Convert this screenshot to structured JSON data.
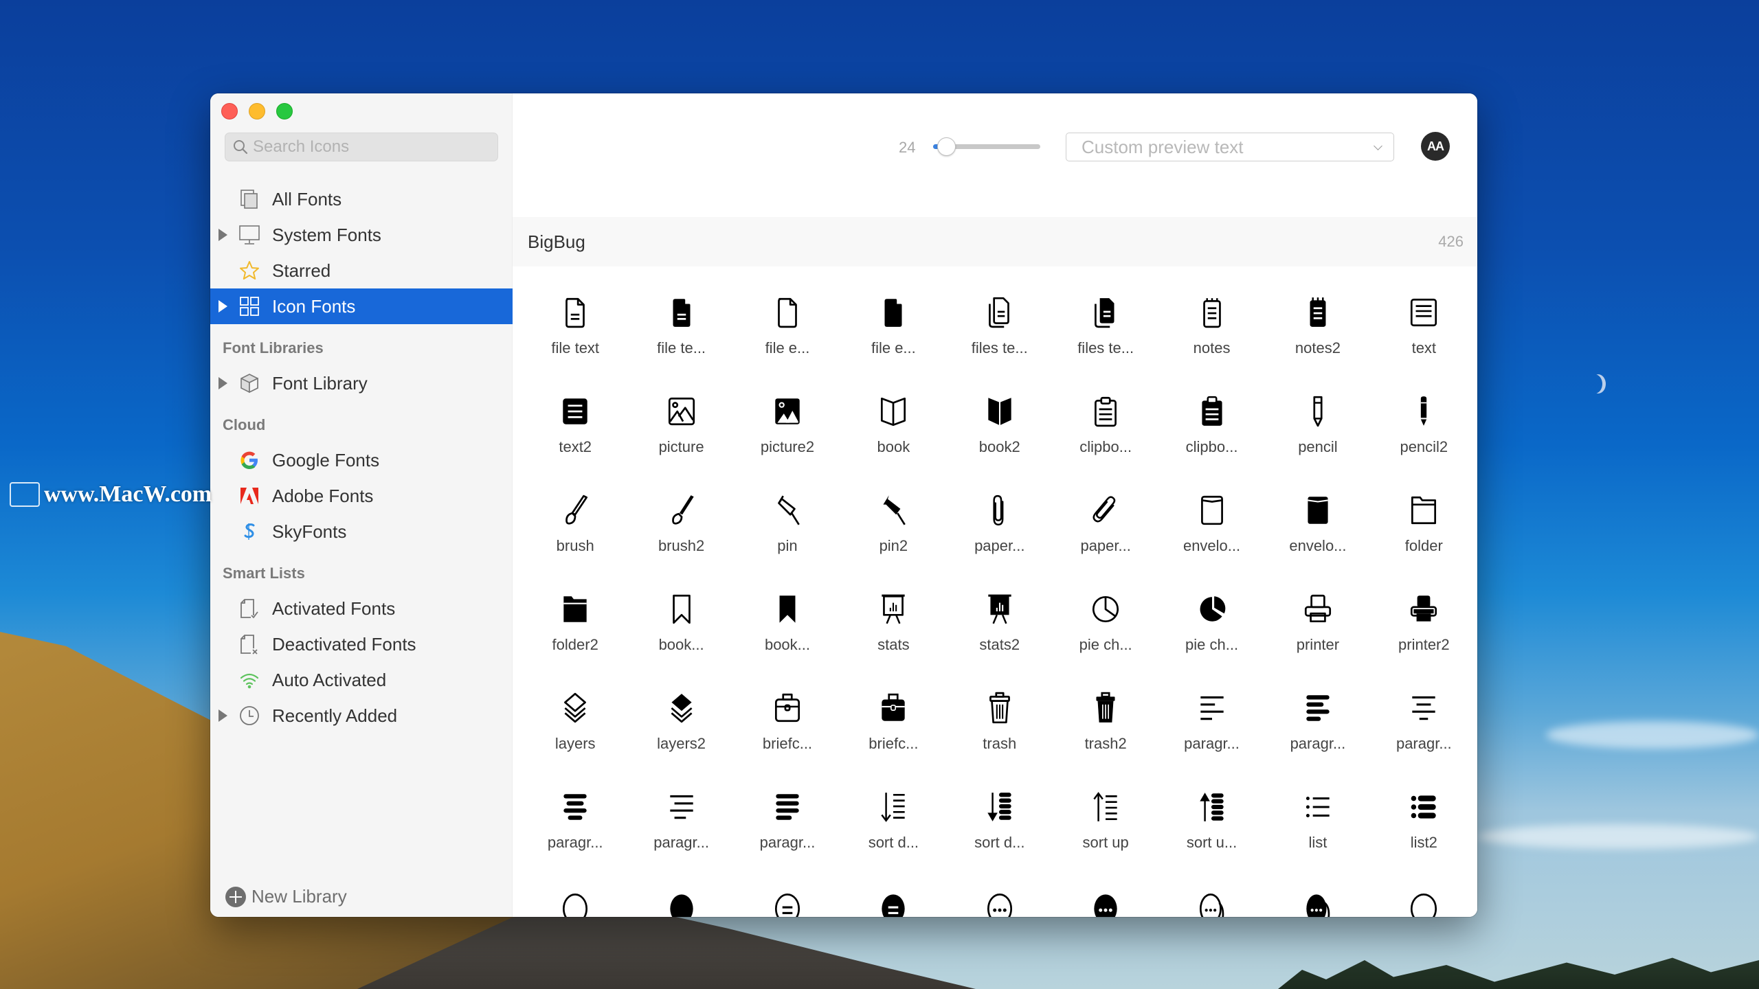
{
  "desktop": {
    "watermark": "www.MacW.com"
  },
  "window": {
    "controls": [
      "close",
      "minimize",
      "zoom"
    ]
  },
  "sidebar": {
    "search_placeholder": "Search Icons",
    "search_value": "",
    "top_items": [
      {
        "label": "All Fonts",
        "icon": "all-fonts-icon",
        "disclosure": false,
        "selected": false
      },
      {
        "label": "System Fonts",
        "icon": "monitor-icon",
        "disclosure": true,
        "selected": false
      },
      {
        "label": "Starred",
        "icon": "star-icon",
        "disclosure": false,
        "selected": false
      },
      {
        "label": "Icon Fonts",
        "icon": "grid-icon",
        "disclosure": true,
        "selected": true
      }
    ],
    "sections": [
      {
        "heading": "Font Libraries",
        "items": [
          {
            "label": "Font Library",
            "icon": "cube-icon",
            "disclosure": true
          }
        ]
      },
      {
        "heading": "Cloud",
        "items": [
          {
            "label": "Google Fonts",
            "icon": "google-icon",
            "disclosure": false
          },
          {
            "label": "Adobe Fonts",
            "icon": "adobe-icon",
            "disclosure": false
          },
          {
            "label": "SkyFonts",
            "icon": "skyfonts-icon",
            "disclosure": false
          }
        ]
      },
      {
        "heading": "Smart Lists",
        "items": [
          {
            "label": "Activated Fonts",
            "icon": "doc-check-icon",
            "disclosure": false
          },
          {
            "label": "Deactivated Fonts",
            "icon": "doc-x-icon",
            "disclosure": false
          },
          {
            "label": "Auto Activated",
            "icon": "wifi-icon",
            "disclosure": false
          },
          {
            "label": "Recently Added",
            "icon": "clock-icon",
            "disclosure": true
          }
        ]
      }
    ],
    "new_library_label": "New Library"
  },
  "toolbar": {
    "size_value": "24",
    "size_slider_fraction": 0.12,
    "preview_placeholder": "Custom preview text",
    "aa_label": "AA"
  },
  "font": {
    "name": "BigBug",
    "count": "426"
  },
  "colors": {
    "selection": "#1868d9",
    "slider_fill": "#3b82e0",
    "google_blue": "#4285f4",
    "adobe_red": "#e8291c",
    "skyfonts_blue": "#2f8fe6",
    "auto_green": "#5dc35d",
    "star_yellow": "#f1b92c"
  },
  "icons": [
    {
      "label": "file text",
      "glyph": "file-text"
    },
    {
      "label": "file te...",
      "glyph": "file-text-solid"
    },
    {
      "label": "file e...",
      "glyph": "file-empty"
    },
    {
      "label": "file e...",
      "glyph": "file-empty-solid"
    },
    {
      "label": "files te...",
      "glyph": "files-text"
    },
    {
      "label": "files te...",
      "glyph": "files-text-solid"
    },
    {
      "label": "notes",
      "glyph": "notes"
    },
    {
      "label": "notes2",
      "glyph": "notes-solid"
    },
    {
      "label": "text",
      "glyph": "text"
    },
    {
      "label": "text2",
      "glyph": "text-solid"
    },
    {
      "label": "picture",
      "glyph": "picture"
    },
    {
      "label": "picture2",
      "glyph": "picture-solid"
    },
    {
      "label": "book",
      "glyph": "book"
    },
    {
      "label": "book2",
      "glyph": "book-solid"
    },
    {
      "label": "clipbo...",
      "glyph": "clipboard"
    },
    {
      "label": "clipbo...",
      "glyph": "clipboard-solid"
    },
    {
      "label": "pencil",
      "glyph": "pencil"
    },
    {
      "label": "pencil2",
      "glyph": "pencil-solid"
    },
    {
      "label": "brush",
      "glyph": "brush"
    },
    {
      "label": "brush2",
      "glyph": "brush-solid"
    },
    {
      "label": "pin",
      "glyph": "pin"
    },
    {
      "label": "pin2",
      "glyph": "pin-solid"
    },
    {
      "label": "paper...",
      "glyph": "paperclip"
    },
    {
      "label": "paper...",
      "glyph": "paperclip-tilted"
    },
    {
      "label": "envelo...",
      "glyph": "envelope"
    },
    {
      "label": "envelo...",
      "glyph": "envelope-solid"
    },
    {
      "label": "folder",
      "glyph": "folder"
    },
    {
      "label": "folder2",
      "glyph": "folder-solid"
    },
    {
      "label": "book...",
      "glyph": "bookmark"
    },
    {
      "label": "book...",
      "glyph": "bookmark-solid"
    },
    {
      "label": "stats",
      "glyph": "stats"
    },
    {
      "label": "stats2",
      "glyph": "stats-solid"
    },
    {
      "label": "pie ch...",
      "glyph": "pie-chart"
    },
    {
      "label": "pie ch...",
      "glyph": "pie-chart-solid"
    },
    {
      "label": "printer",
      "glyph": "printer"
    },
    {
      "label": "printer2",
      "glyph": "printer-solid"
    },
    {
      "label": "layers",
      "glyph": "layers"
    },
    {
      "label": "layers2",
      "glyph": "layers-solid"
    },
    {
      "label": "briefc...",
      "glyph": "briefcase"
    },
    {
      "label": "briefc...",
      "glyph": "briefcase-solid"
    },
    {
      "label": "trash",
      "glyph": "trash"
    },
    {
      "label": "trash2",
      "glyph": "trash-solid"
    },
    {
      "label": "paragr...",
      "glyph": "paragraph-left"
    },
    {
      "label": "paragr...",
      "glyph": "paragraph-left-solid"
    },
    {
      "label": "paragr...",
      "glyph": "paragraph-center"
    },
    {
      "label": "paragr...",
      "glyph": "paragraph-center-solid"
    },
    {
      "label": "paragr...",
      "glyph": "paragraph-right"
    },
    {
      "label": "paragr...",
      "glyph": "paragraph-right-solid"
    },
    {
      "label": "sort d...",
      "glyph": "sort-down"
    },
    {
      "label": "sort d...",
      "glyph": "sort-down-solid"
    },
    {
      "label": "sort up",
      "glyph": "sort-up"
    },
    {
      "label": "sort u...",
      "glyph": "sort-up-solid"
    },
    {
      "label": "list",
      "glyph": "list"
    },
    {
      "label": "list2",
      "glyph": "list-solid"
    },
    {
      "label": "",
      "glyph": "bubble"
    },
    {
      "label": "",
      "glyph": "bubble-solid"
    },
    {
      "label": "",
      "glyph": "bubble-text"
    },
    {
      "label": "",
      "glyph": "bubble-text-solid"
    },
    {
      "label": "",
      "glyph": "bubble-dots"
    },
    {
      "label": "",
      "glyph": "bubble-dots-solid"
    },
    {
      "label": "",
      "glyph": "bubbles-dots"
    },
    {
      "label": "",
      "glyph": "bubbles-dots-solid"
    },
    {
      "label": "",
      "glyph": "bubble-2"
    }
  ]
}
